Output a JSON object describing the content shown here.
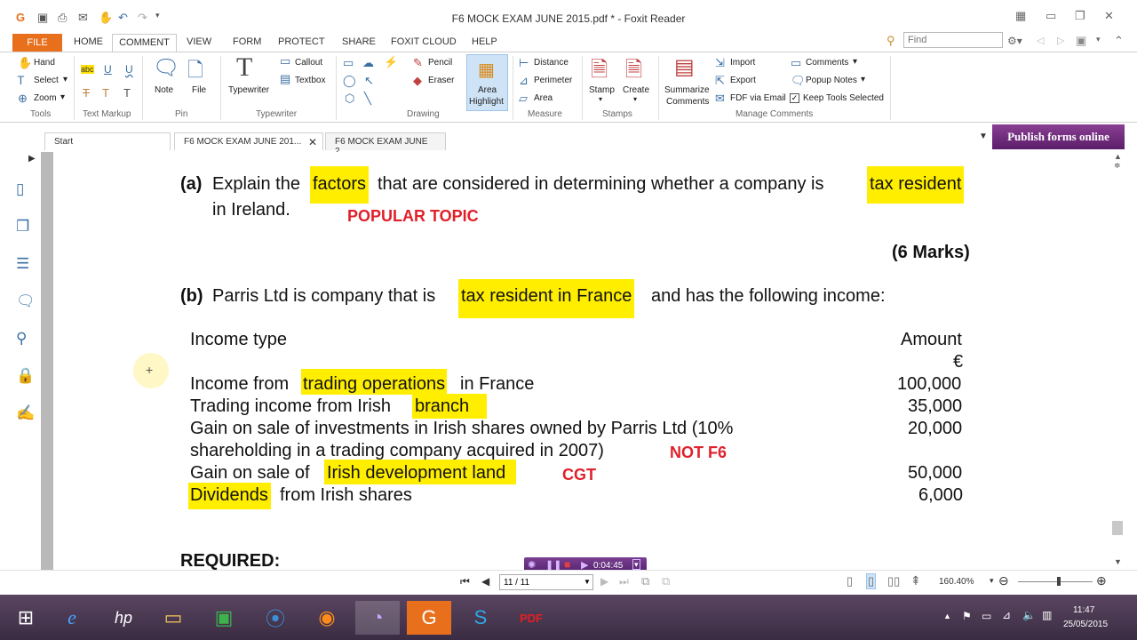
{
  "window": {
    "title": "F6 MOCK EXAM JUNE 2015.pdf * - Foxit Reader"
  },
  "menus": [
    "FILE",
    "HOME",
    "COMMENT",
    "VIEW",
    "FORM",
    "PROTECT",
    "SHARE",
    "FOXIT CLOUD",
    "HELP"
  ],
  "find": {
    "placeholder": "Find"
  },
  "ribbon": {
    "tools": {
      "hand": "Hand",
      "select": "Select",
      "zoom": "Zoom",
      "group": "Tools"
    },
    "text_markup": {
      "group": "Text Markup"
    },
    "pin": {
      "note": "Note",
      "file": "File",
      "group": "Pin"
    },
    "typewriter": {
      "typewriter": "Typewriter",
      "callout": "Callout",
      "textbox": "Textbox",
      "group": "Typewriter"
    },
    "drawing": {
      "pencil": "Pencil",
      "eraser": "Eraser",
      "area_highlight_1": "Area",
      "area_highlight_2": "Highlight",
      "group": "Drawing"
    },
    "measure": {
      "distance": "Distance",
      "perimeter": "Perimeter",
      "area": "Area",
      "group": "Measure"
    },
    "stamps": {
      "stamp": "Stamp",
      "create": "Create",
      "group": "Stamps"
    },
    "manage": {
      "summarize_1": "Summarize",
      "summarize_2": "Comments",
      "import": "Import",
      "export": "Export",
      "fdf": "FDF via Email",
      "comments": "Comments",
      "popup": "Popup Notes",
      "keep": "Keep Tools Selected",
      "group": "Manage Comments"
    }
  },
  "tabs": {
    "start": "Start",
    "tab1": "F6 MOCK EXAM JUNE 201...",
    "tab2": "F6 MOCK EXAM JUNE 2..."
  },
  "publish": "Publish forms online",
  "document": {
    "a_label": "(a)",
    "a_pre": "Explain the ",
    "a_hl1": "factors",
    "a_mid": " that are considered in determining whether a company is ",
    "a_hl2": "tax resident",
    "a_line2": "in Ireland.",
    "popular": "POPULAR TOPIC",
    "marks": "(6 Marks)",
    "b_label": "(b)",
    "b_pre": "Parris Ltd is company that is ",
    "b_hl": "tax resident in France",
    "b_post": " and has the following income:",
    "income_header": "Income type",
    "amount_header": "Amount",
    "currency": "€",
    "row1_pre": "Income from ",
    "row1_hl": "trading operations",
    "row1_post": " in France",
    "row1_amt": "100,000",
    "row2_pre": "Trading income from Irish ",
    "row2_hl": "branch",
    "row2_amt": "35,000",
    "row3_line1": "Gain on sale of investments in Irish shares owned by Parris Ltd (10%",
    "row3_line2": "shareholding in a trading company acquired in 2007)",
    "not_f6": "NOT F6",
    "row3_amt": "20,000",
    "row4_pre": "Gain on sale of ",
    "row4_hl": "Irish development land",
    "cgt": "CGT",
    "row4_amt": "50,000",
    "row5_hl": "Dividends",
    "row5_post": " from Irish shares",
    "row5_amt": "6,000",
    "required": "REQUIRED:"
  },
  "recorder": {
    "time": "0:04:45"
  },
  "nav": {
    "page": "11 / 11",
    "zoom": "160.40%"
  },
  "clock": {
    "time": "11:47",
    "date": "25/05/2015"
  },
  "colors": {
    "highlight": "#ffee00",
    "annotation_red": "#e0202a",
    "file_menu": "#e8701d",
    "publish": "#6b2a7a"
  }
}
